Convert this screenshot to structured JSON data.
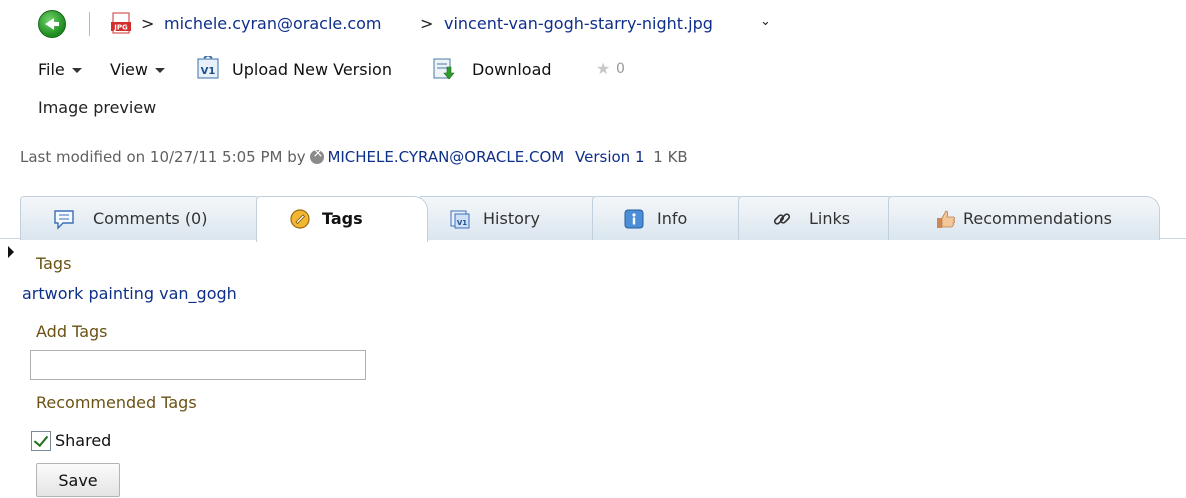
{
  "breadcrumb": {
    "separator": ">",
    "owner": "michele.cyran@oracle.com",
    "file": "vincent-van-gogh-starry-night.jpg",
    "icons": [
      "back-arrow-icon",
      "jpg-file-icon",
      "chevron-down-icon"
    ]
  },
  "toolbar": {
    "file_label": "File",
    "view_label": "View",
    "upload_label": "Upload New Version",
    "download_label": "Download",
    "rating_count": "0"
  },
  "preview_label": "Image preview",
  "meta": {
    "prefix": "Last modified on 10/27/11 5:05 PM  by",
    "user": "MICHELE.CYRAN@ORACLE.COM",
    "version": "Version 1",
    "size": "1 KB"
  },
  "tabs": [
    {
      "label": "Comments (0)",
      "icon": "comment-icon"
    },
    {
      "label": "Tags",
      "icon": "tag-icon",
      "active": true
    },
    {
      "label": "History",
      "icon": "history-icon"
    },
    {
      "label": "Info",
      "icon": "info-icon"
    },
    {
      "label": "Links",
      "icon": "link-icon"
    },
    {
      "label": "Recommendations",
      "icon": "thumbs-up-icon"
    }
  ],
  "tags_panel": {
    "heading": "Tags",
    "tags": [
      "artwork",
      "painting",
      "van_gogh"
    ],
    "add_heading": "Add Tags",
    "add_value": "",
    "recommended_heading": "Recommended Tags",
    "shared_label": "Shared",
    "shared_checked": true,
    "save_label": "Save"
  },
  "colors": {
    "link": "#0e2f8a",
    "section_heading": "#6b5214",
    "tab_bg": "#dbe6ef"
  }
}
